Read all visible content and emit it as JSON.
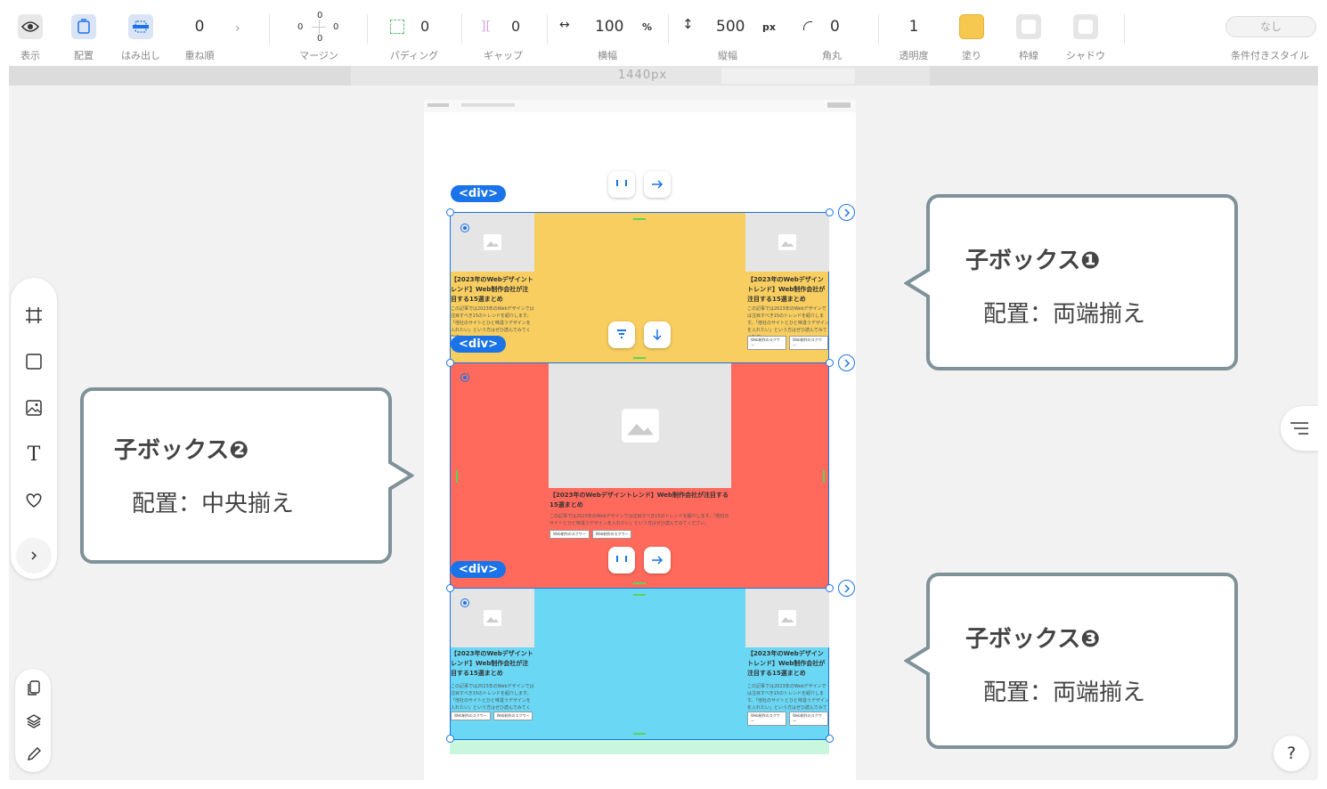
{
  "toolbar": {
    "display_label": "表示",
    "align_label": "配置",
    "overflow_label": "はみ出し",
    "zindex_value": "0",
    "zindex_label": "重ね順",
    "margin": {
      "top": "0",
      "left": "0",
      "right": "0",
      "bottom": "0",
      "label": "マージン"
    },
    "padding": {
      "value": "0",
      "label": "パディング"
    },
    "gap": {
      "value": "0",
      "label": "ギャップ"
    },
    "width": {
      "value": "100",
      "unit": "%",
      "label": "横幅"
    },
    "height": {
      "value": "500",
      "unit": "px",
      "label": "縦幅"
    },
    "radius": {
      "value": "0",
      "label": "角丸"
    },
    "opacity": {
      "value": "1",
      "label": "透明度"
    },
    "fill": {
      "label": "塗り",
      "color": "#f7c84f"
    },
    "border_label": "枠線",
    "shadow_label": "シャドウ",
    "conditional": {
      "button": "なし",
      "label": "条件付きスタイル"
    }
  },
  "ruler": {
    "width_text": "1440px"
  },
  "canvas": {
    "div_tag": "<div>",
    "card": {
      "title": "【2023年のWebデザイントレンド】Web制作会社が注目する15選まとめ",
      "desc": "この記事では2023年のWebデザインでは注目すべき15のトレンドを紹介します。「他社のサイトとひと味違うデザインを入れたい」という方はぜひ読んでみてください。",
      "tags": [
        "Web制作のスクワー",
        "Web制作のスクワー"
      ]
    },
    "colors": {
      "box1": "#f7ce5f",
      "box2": "#ff6a5c",
      "box3": "#6ad7f4",
      "selection": "#1a73e8"
    }
  },
  "callouts": [
    {
      "title": "子ボックス❶",
      "sub": "配置：両端揃え"
    },
    {
      "title": "子ボックス❷",
      "sub": "配置：中央揃え"
    },
    {
      "title": "子ボックス❸",
      "sub": "配置：両端揃え"
    }
  ],
  "help": "?"
}
